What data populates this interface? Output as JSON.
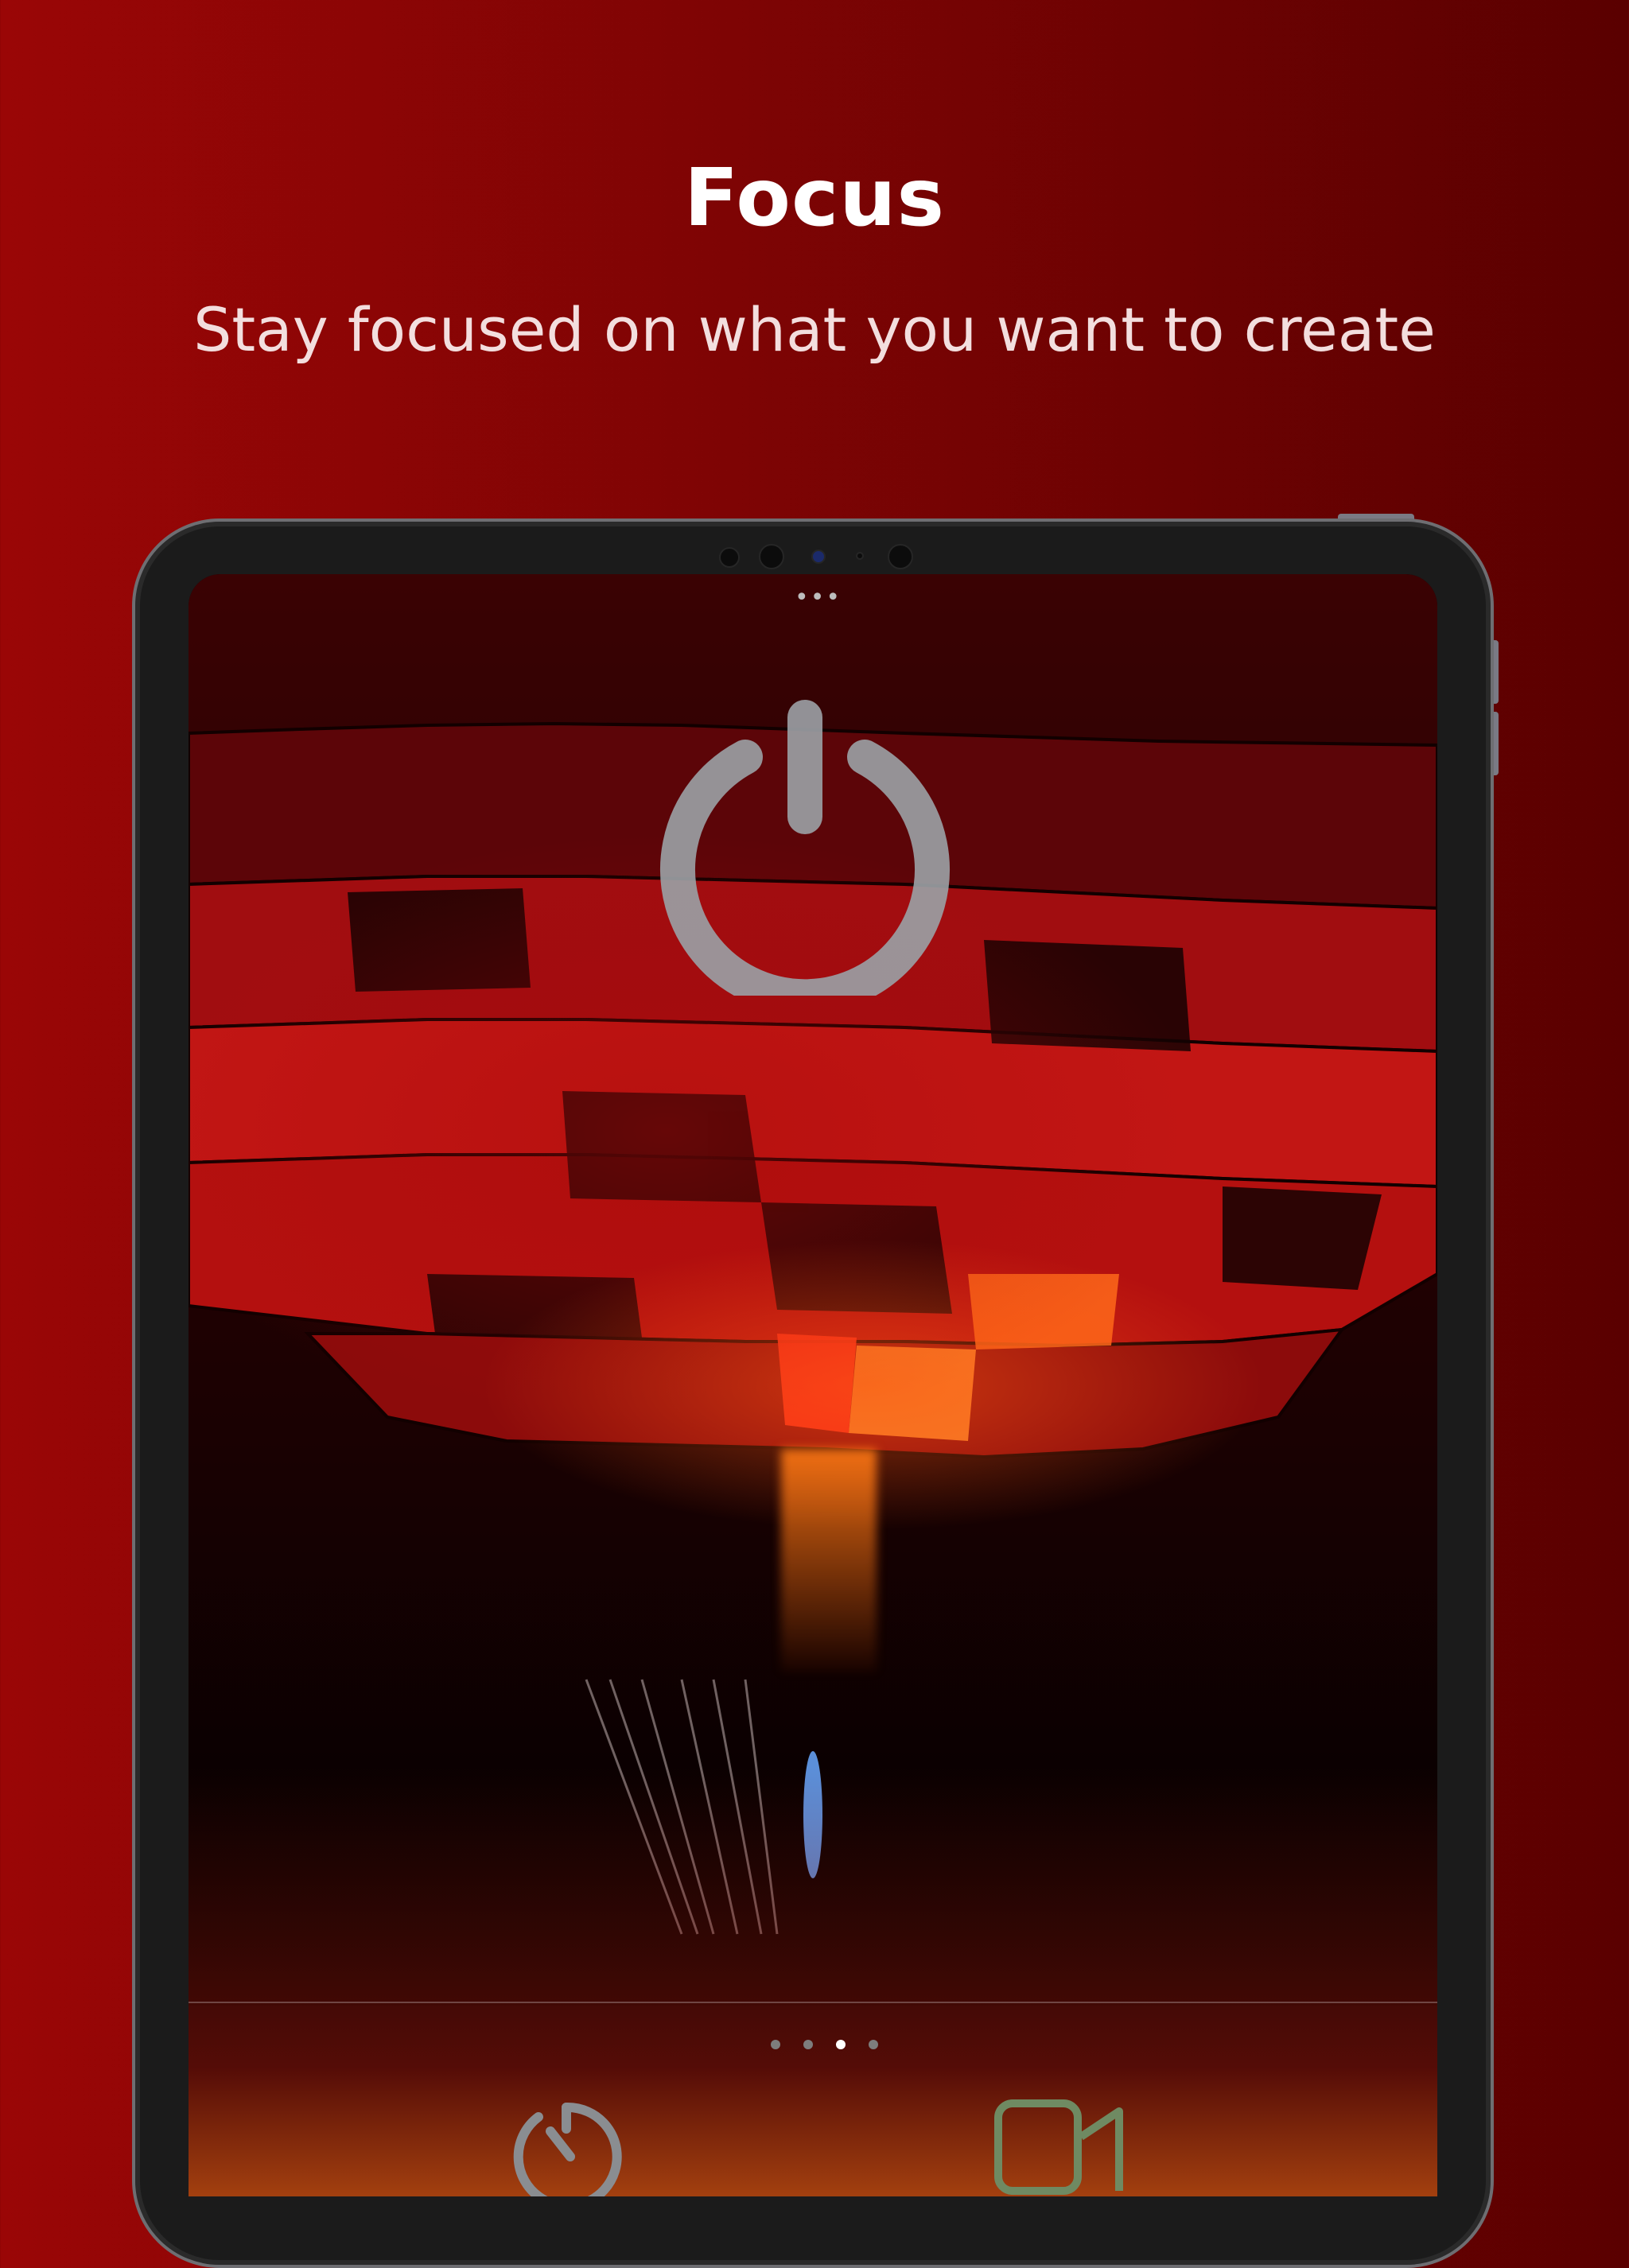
{
  "headline": "Focus",
  "subline": "Stay focused on what you want to create",
  "device": {
    "screen": {
      "drag_handle": "•••",
      "power_button": {
        "icon": "power-icon",
        "color": "#9a9ea3"
      },
      "page_indicator": {
        "total": 4,
        "active": 3
      },
      "tabs": [
        {
          "icon": "timer-icon"
        },
        {
          "icon": "video-camera-icon"
        }
      ]
    }
  },
  "colors": {
    "background_left": "#9a0606",
    "background_right": "#5a0000",
    "headline": "#ffffff",
    "subline": "#f3dede"
  }
}
